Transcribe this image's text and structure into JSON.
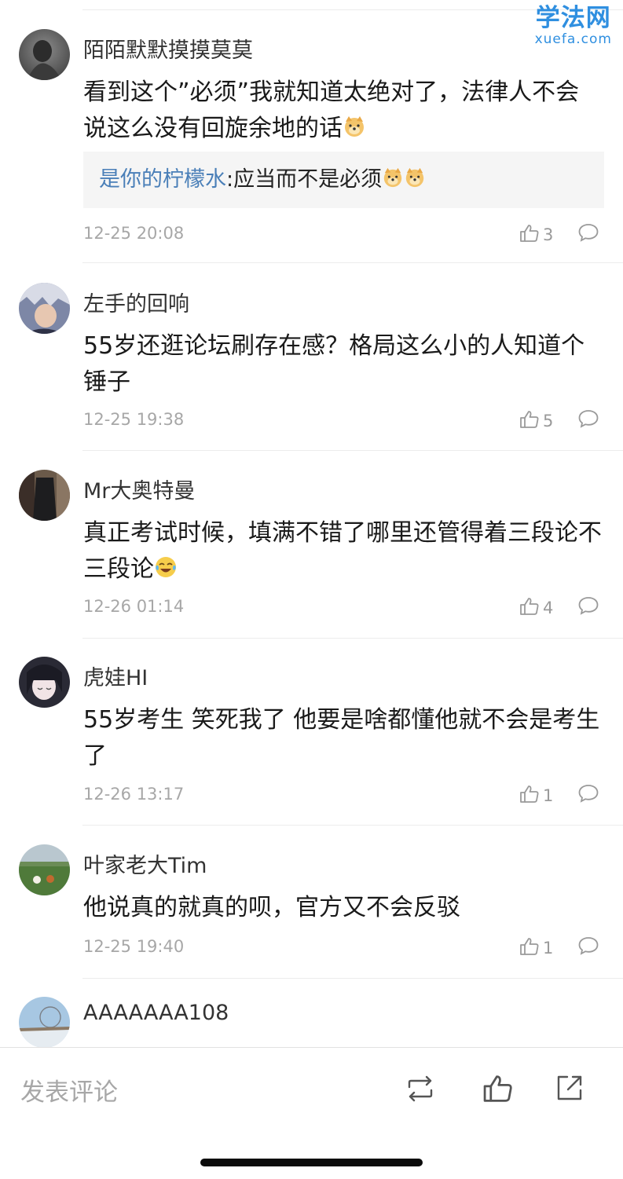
{
  "watermark": {
    "cn": "学法网",
    "en": "xuefa.com"
  },
  "comments": [
    {
      "user": "陌陌默默摸摸莫莫",
      "text": "看到这个”必须”我就知道太绝对了，法律人不会说这么没有回旋余地的话",
      "emoji": "doge",
      "reply": {
        "user": "是你的柠檬水",
        "sep": ":",
        "text": "应当而不是必须",
        "emoji": [
          "doge",
          "doge"
        ]
      },
      "time": "12-25 20:08",
      "likes": "3"
    },
    {
      "user": "左手的回响",
      "text": "55岁还逛论坛刷存在感？格局这么小的人知道个锤子",
      "time": "12-25 19:38",
      "likes": "5"
    },
    {
      "user": "Mr大奥特曼",
      "text": "真正考试时候，填满不错了哪里还管得着三段论不三段论",
      "emoji": "laugh-cry",
      "time": "12-26 01:14",
      "likes": "4"
    },
    {
      "user": "虎娃HI",
      "text": "55岁考生 笑死我了 他要是啥都懂他就不会是考生了",
      "time": "12-26 13:17",
      "likes": "1"
    },
    {
      "user": "叶家老大Tim",
      "text": "他说真的就真的呗，官方又不会反驳",
      "time": "12-25 19:40",
      "likes": "1"
    },
    {
      "user": "AAAAAAA108"
    }
  ],
  "bottom_bar": {
    "compose_placeholder": "发表评论",
    "icons": [
      "repost-icon",
      "thumbs-up-icon",
      "share-icon"
    ]
  },
  "colors": {
    "accent_blue": "#4a7fb8",
    "watermark_blue": "#2f8fe0",
    "meta_gray": "#a7a7a7"
  }
}
